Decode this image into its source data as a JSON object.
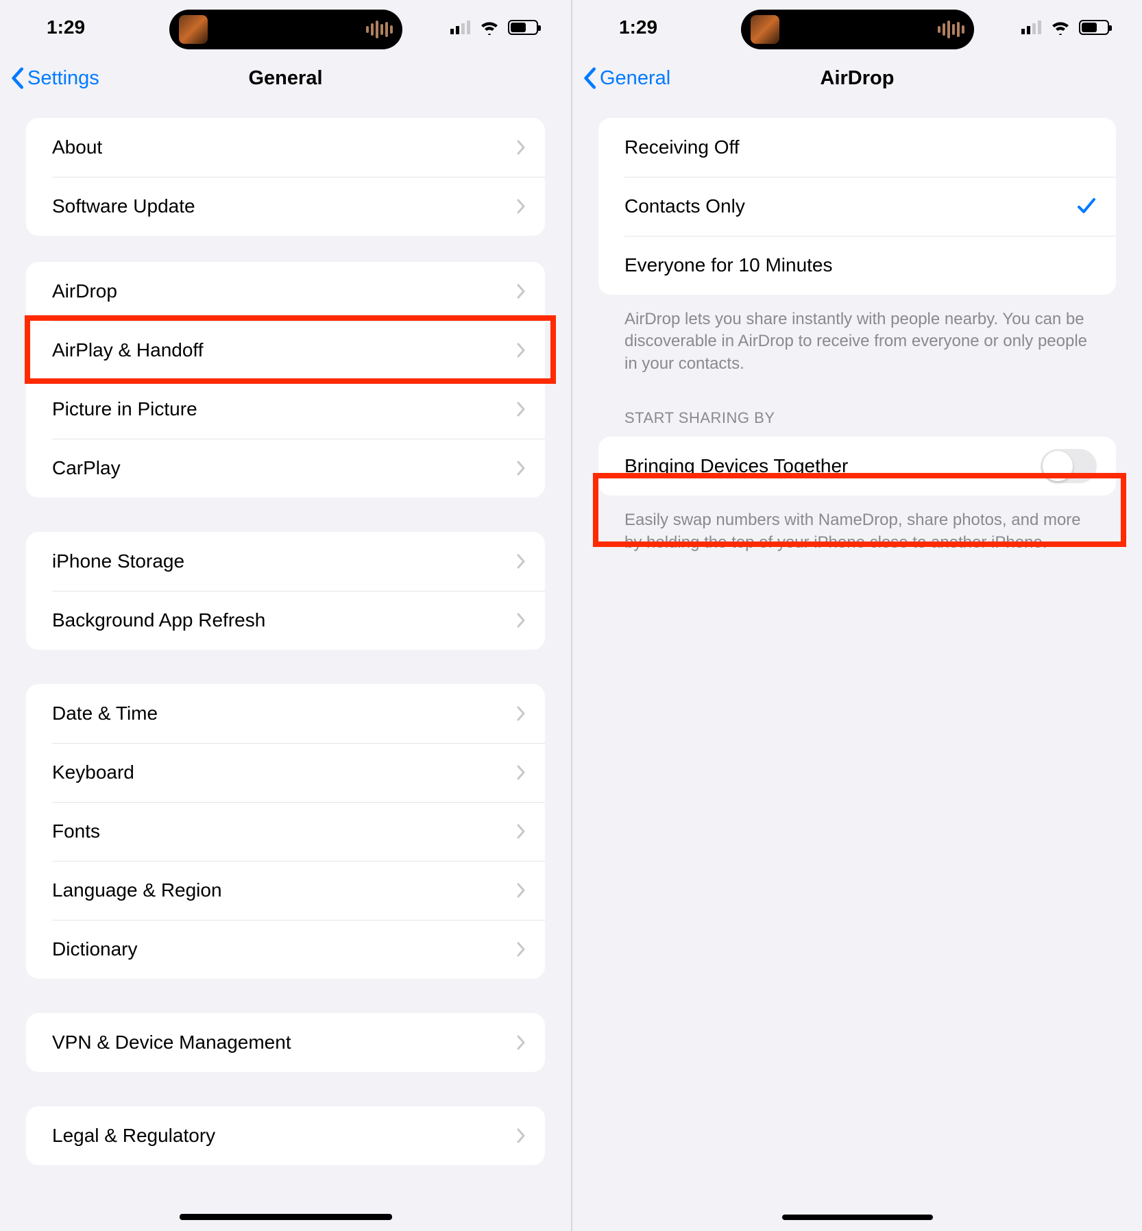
{
  "status": {
    "time": "1:29"
  },
  "left": {
    "back_label": "Settings",
    "title": "General",
    "groups": [
      {
        "rows": [
          {
            "label": "About"
          },
          {
            "label": "Software Update"
          }
        ]
      },
      {
        "rows": [
          {
            "label": "AirDrop",
            "highlighted": true
          },
          {
            "label": "AirPlay & Handoff"
          },
          {
            "label": "Picture in Picture"
          },
          {
            "label": "CarPlay"
          }
        ]
      },
      {
        "rows": [
          {
            "label": "iPhone Storage"
          },
          {
            "label": "Background App Refresh"
          }
        ]
      },
      {
        "rows": [
          {
            "label": "Date & Time"
          },
          {
            "label": "Keyboard"
          },
          {
            "label": "Fonts"
          },
          {
            "label": "Language & Region"
          },
          {
            "label": "Dictionary"
          }
        ]
      },
      {
        "rows": [
          {
            "label": "VPN & Device Management"
          }
        ]
      },
      {
        "rows": [
          {
            "label": "Legal & Regulatory"
          }
        ]
      }
    ]
  },
  "right": {
    "back_label": "General",
    "title": "AirDrop",
    "receiving_options": [
      {
        "label": "Receiving Off",
        "selected": false
      },
      {
        "label": "Contacts Only",
        "selected": true
      },
      {
        "label": "Everyone for 10 Minutes",
        "selected": false
      }
    ],
    "receiving_footer": "AirDrop lets you share instantly with people nearby. You can be discoverable in AirDrop to receive from everyone or only people in your contacts.",
    "sharing_header": "START SHARING BY",
    "sharing_row_label": "Bringing Devices Together",
    "sharing_toggle_on": false,
    "sharing_footer": "Easily swap numbers with NameDrop, share photos, and more by holding the top of your iPhone close to another iPhone."
  },
  "highlight_color": "#ff2a00"
}
